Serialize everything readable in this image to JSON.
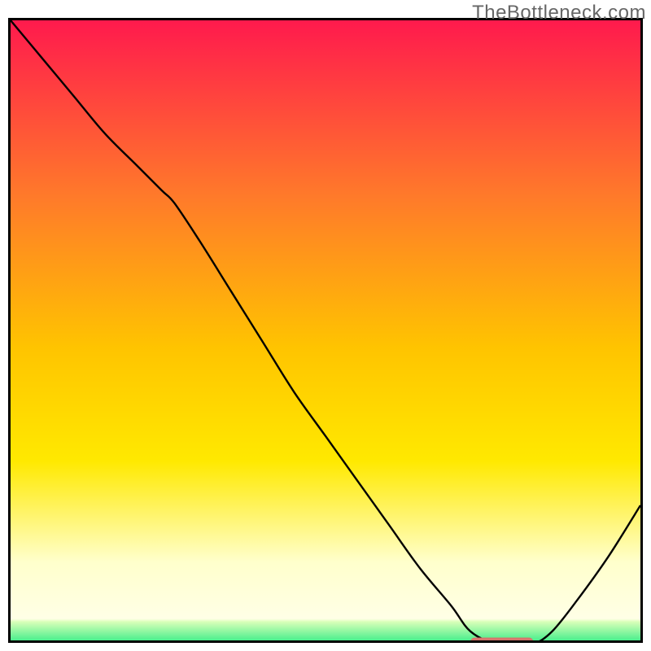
{
  "watermark": "TheBottleneck.com",
  "colors": {
    "top": "#ff1a4d",
    "upper_mid": "#ff7a2a",
    "mid": "#ffc400",
    "lower_mid": "#ffe900",
    "pale": "#ffffcc",
    "bottom_band": "#00e676",
    "curve": "#000000",
    "marker": "#d6756c"
  },
  "chart_data": {
    "type": "line",
    "title": "",
    "xlabel": "",
    "ylabel": "",
    "xlim": [
      0,
      100
    ],
    "ylim": [
      0,
      100
    ],
    "grid": false,
    "series": [
      {
        "name": "bottleneck-curve",
        "x": [
          0,
          5,
          10,
          15,
          20,
          24,
          26,
          30,
          35,
          40,
          45,
          50,
          55,
          60,
          65,
          70,
          73,
          77,
          80,
          83,
          86,
          90,
          95,
          100
        ],
        "y": [
          100,
          94,
          88,
          82,
          77,
          73,
          71,
          65,
          57,
          49,
          41,
          34,
          27,
          20,
          13,
          7,
          3,
          1,
          1,
          1,
          3,
          8,
          15,
          23
        ]
      }
    ],
    "optimal_band": {
      "x_start": 73,
      "x_end": 83,
      "y": 1.2
    },
    "legend": null
  }
}
